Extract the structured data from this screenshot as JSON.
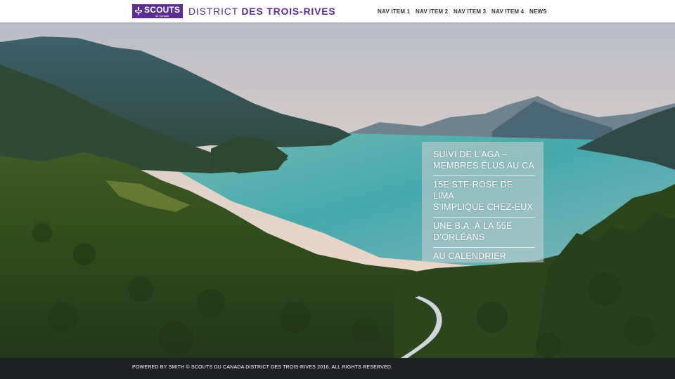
{
  "header": {
    "logo": {
      "word": "SCOUTS",
      "sub": "du Canada"
    },
    "site_title_part1": "DISTRICT ",
    "site_title_part2": "DES TROIS-RIVES",
    "nav": [
      "NAV ITEM 1",
      "NAV ITEM 2",
      "NAV ITEM 3",
      "NAV ITEM 4",
      "NEWS"
    ]
  },
  "news": [
    {
      "line1": "SUIVI DE L’AGA –",
      "line2": "MEMBRES ÉLUS AU CA"
    },
    {
      "line1": "15E STE-ROSE DE LIMA",
      "line2": "S’IMPLIQUE CHEZ-EUX"
    },
    {
      "line1": "UNE B.A. À LA 55E",
      "line2": "D’ORLÉANS"
    },
    {
      "line1": "AU CALENDRIER",
      "line2": ""
    }
  ],
  "footer": {
    "text": "POWERED BY SMITH © SCOUTS DU CANADA DISTRICT DES TROIS-RIVES 2016. ALL RIGHTS RESERVED."
  },
  "colors": {
    "brand_purple": "#5c2e91",
    "footer_bg": "#1f2124",
    "water": "#4fb0b0"
  }
}
